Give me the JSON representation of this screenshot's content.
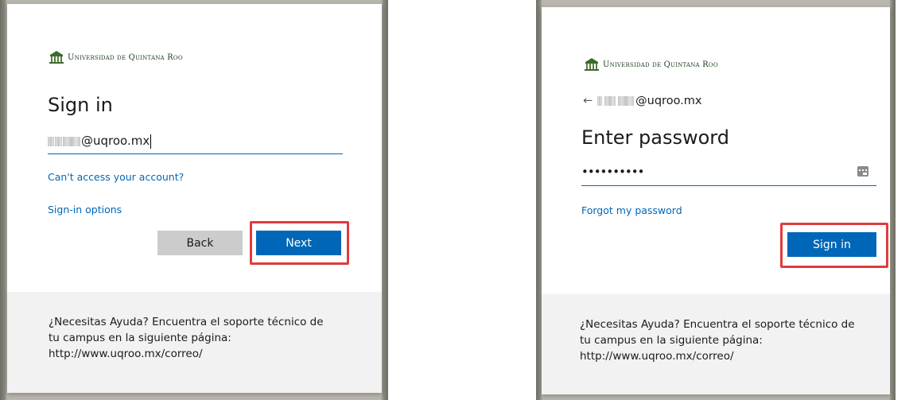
{
  "org": {
    "name": "Universidad de Quintana Roo"
  },
  "left_dialog": {
    "title": "Sign in",
    "email_domain": "@uqroo.mx",
    "cant_access_link": "Can't access your account?",
    "signin_options_link": "Sign-in options",
    "back_button": "Back",
    "next_button": "Next"
  },
  "right_dialog": {
    "identity_domain": "@uqroo.mx",
    "back_arrow": "←",
    "title": "Enter password",
    "password_mask": "••••••••••",
    "forgot_link": "Forgot my password",
    "signin_button": "Sign in"
  },
  "footer": {
    "line1": "¿Necesitas Ayuda? Encuentra el soporte técnico de",
    "line2": "tu campus en la siguiente página:",
    "line3": "http://www.uqroo.mx/correo/"
  },
  "colors": {
    "accent": "#0067b8",
    "highlight": "#e03c3c",
    "back_button": "#cccccc",
    "footer_bg": "#f2f2f2"
  },
  "icons": {
    "reveal_password": "show-password-icon",
    "logo": "university-crest-icon"
  }
}
